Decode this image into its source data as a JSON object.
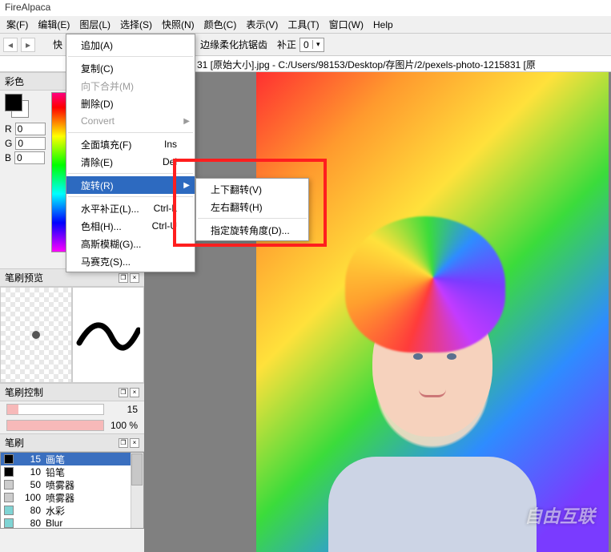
{
  "app_title": "FireAlpaca",
  "menubar": {
    "file": "案(F)",
    "edit": "编辑(E)",
    "layer": "图层(L)",
    "select": "选择(S)",
    "snapshot": "快照(N)",
    "color": "颜色(C)",
    "view": "表示(V)",
    "tool": "工具(T)",
    "window": "窗口(W)",
    "help": "Help"
  },
  "toolbar": {
    "quick_label": "快",
    "antialias_label": "边缘柔化抗锯齿",
    "correction_label": "补正",
    "correction_value": "0"
  },
  "doc_path": "31 [原始大小].jpg - C:/Users/98153/Desktop/存图片/2/pexels-photo-1215831 [原",
  "color_panel": {
    "title": "彩色",
    "r_label": "R",
    "r_value": "0",
    "g_label": "G",
    "g_value": "0",
    "b_label": "B",
    "b_value": "0"
  },
  "brush_preview_title": "笔刷预览",
  "brush_control": {
    "title": "笔刷控制",
    "size_value": "15",
    "opacity_value": "100 %"
  },
  "brush_panel": {
    "title": "笔刷",
    "items": [
      {
        "size": "15",
        "name": "画笔",
        "swatch": "#000000",
        "selected": true
      },
      {
        "size": "10",
        "name": "铅笔",
        "swatch": "#000000"
      },
      {
        "size": "50",
        "name": "喷雾器",
        "swatch": "#cccccc"
      },
      {
        "size": "100",
        "name": "喷雾器",
        "swatch": "#cccccc"
      },
      {
        "size": "80",
        "name": "水彩",
        "swatch": "#7fd4d4"
      },
      {
        "size": "80",
        "name": "Blur",
        "swatch": "#7fd4d4"
      }
    ]
  },
  "layer_menu": {
    "add": "追加(A)",
    "duplicate": "复制(C)",
    "merge_down": "向下合并(M)",
    "delete": "删除(D)",
    "convert": "Convert",
    "fill": "全面填充(F)",
    "fill_accel": "Ins",
    "clear": "清除(E)",
    "clear_accel": "Del",
    "rotate": "旋转(R)",
    "level": "水平补正(L)...",
    "level_accel": "Ctrl-L",
    "hue": "色相(H)...",
    "hue_accel": "Ctrl-U",
    "gaussian": "高斯模糊(G)...",
    "mosaic": "马赛克(S)..."
  },
  "rotate_submenu": {
    "flip_v": "上下翻转(V)",
    "flip_h": "左右翻转(H)",
    "arbitrary": "指定旋转角度(D)..."
  },
  "watermark": "自由互联"
}
